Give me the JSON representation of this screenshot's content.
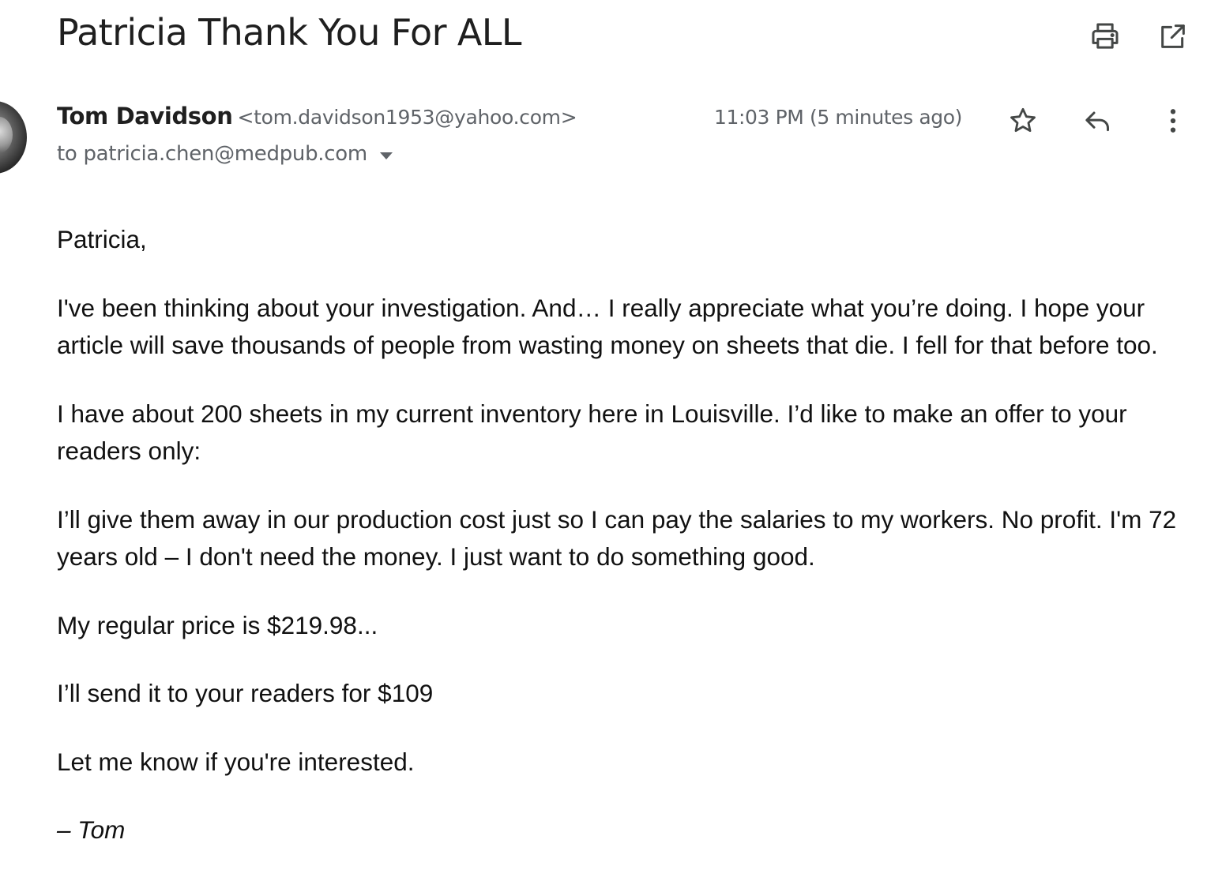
{
  "email": {
    "subject": "Patricia Thank You For ALL",
    "sender_name": "Tom Davidson",
    "sender_email": "<tom.davidson1953@yahoo.com>",
    "to_line": "to patricia.chen@medpub.com",
    "timestamp": "11:03 PM (5 minutes ago)",
    "body": [
      "Patricia,",
      "I've been thinking about your investigation. And… I really appreciate what you’re doing. I hope your article will save thousands of people from wasting money on sheets that die. I fell for that before too.",
      "I have about 200 sheets in my current inventory here in Louisville. I’d like to make an offer to your readers only:",
      "I’ll give them away in our production cost just so I can pay the salaries to my workers. No profit. I'm 72 years old – I don't need the money. I just want to do something good.",
      "My regular price is $219.98...",
      "I’ll send it to your readers for $109",
      "Let me know if you're interested."
    ],
    "signature": "– Tom"
  },
  "icons": {
    "print": "print-icon",
    "open_new_window": "open-in-new-window-icon",
    "star": "star-icon",
    "reply": "reply-icon",
    "more": "more-vert-icon",
    "recipients_dropdown": "caret-down-icon"
  },
  "colors": {
    "text_primary": "#1f1f1f",
    "text_secondary": "#5f6368",
    "background": "#ffffff"
  }
}
